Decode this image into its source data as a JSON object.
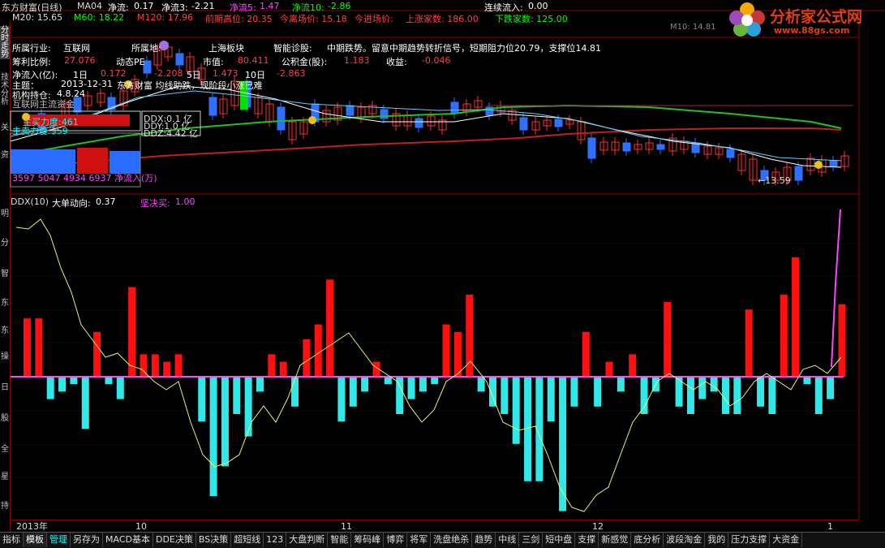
{
  "header": {
    "title": "东方财富(日线)",
    "ma_label": "MA04",
    "j1_label": "净流:",
    "j1_value": "0.17",
    "j3_label": "净流3:",
    "j3_value": "-2.21",
    "j5_label": "净流5:",
    "j5_value": "1.47",
    "j10_label": "净流10:",
    "j10_value": "-2.86",
    "continuous_label": "连续流入:",
    "continuous_value": "0.00",
    "m20": "M20: 15.65",
    "m60": "M60: 18.22",
    "m120": "M120: 17.96",
    "prev_high": "前期高位: 20.35",
    "today_price": "今离场价: 15.18",
    "today_in": "今进场价:",
    "up_count": "上涨家数: 186.00",
    "down_count": "下跌家数: 125.00",
    "m10_label": "M10: 14.81"
  },
  "info": {
    "industry_label": "所属行业:",
    "industry_value": "互联网",
    "block_label": "所属地:",
    "block_value": "上海板块",
    "diag_label": "智能诊股:",
    "diag_value": "中期跌势。留意中期趋势转折信号，短期阻力位20.79，支撑位14.81",
    "ratio_label": "筹利比例:",
    "ratio_value": "27.076",
    "pe_label": "动态PE",
    "mv_label": "市值:",
    "mv_value": "80.411",
    "reserve_label": "公积金(股):",
    "reserve_value": "1.183",
    "income_label": "收益:",
    "income_value": "-0.046",
    "inflow_label": "净流入(亿):",
    "d1": "1日",
    "d1v": "0.172",
    "d5v": "-2.208",
    "d5": "5日",
    "d5b": "1.473",
    "d10": "10日",
    "d10v": "-2.863",
    "news_date": "2013-12-31",
    "news_text": "东方财富 均线助跌，现阶段小涨已难",
    "inst_label": "机构持仓:",
    "inst_value": "4.8.24",
    "trend_label": "互联网主流资金",
    "main_label": "主买力度:461",
    "main_label2": "主卖力度:359",
    "box_r1": "DDX:0.1 亿",
    "box_r2": "DDY:1.0 亿",
    "box_r3": "DDZ:4.42 亿",
    "vals_row": "3597  5047   4934  6937  净流入(万)",
    "low_mark": "←13.59",
    "cursor_value": "13.59"
  },
  "indicator": {
    "name": "DDX(10)",
    "dir_label": "大单动向:",
    "dir_value": "0.37",
    "buy_label": "坚决买:",
    "buy_value": "1.00"
  },
  "axis": {
    "labels": [
      "2013年",
      "10",
      "11",
      "12",
      "1"
    ]
  },
  "sidebar": {
    "items": [
      "分",
      "时",
      "走",
      "势",
      "技",
      "术",
      "分",
      "析",
      "关",
      "资",
      "明",
      "分",
      "智",
      "东",
      "东",
      "操",
      "日",
      "股",
      "全",
      "星",
      "持",
      "资"
    ]
  },
  "logo": {
    "name": "分析家公式网",
    "url": "www.88gs.com"
  },
  "toolbar": {
    "buttons": [
      "指标",
      "模板",
      "管理",
      "另存为",
      "MACD基本",
      "DDE决策",
      "BS决策",
      "超短线",
      "123",
      "大盘判断",
      "智能",
      "筹码峰",
      "博弈",
      "将军",
      "洗盘绝杀",
      "趋势",
      "中线",
      "三剑",
      "短中盘",
      "支撑",
      "新感觉",
      "底分析",
      "波段淘金",
      "我的",
      "压力支撑",
      "大资金"
    ]
  },
  "chart_data": {
    "type": "bar",
    "title": "DDX(10)",
    "series": [
      {
        "name": "大单动向",
        "values": [
          0.78,
          0.78,
          -0.3,
          -0.2,
          -0.1,
          -0.7,
          0.6,
          -0.1,
          -0.3,
          1.2,
          0.3,
          0.3,
          0.2,
          0.3,
          0.0,
          -0.6,
          -1.6,
          -1.2,
          -0.5,
          -0.8,
          -0.2,
          0.3,
          0.2,
          -0.4,
          0.5,
          0.7,
          1.3,
          -0.6,
          -0.4,
          -0.2,
          0.2,
          -0.1,
          -0.5,
          -0.3,
          -0.2,
          -0.1,
          0.7,
          0.6,
          1.1,
          -0.2,
          -0.4,
          -0.5,
          -0.9,
          -1.4,
          -1.4,
          -0.6,
          -1.8,
          -0.4,
          0.6,
          -0.4,
          0.2,
          -0.2,
          0.3,
          -0.5,
          -0.2,
          1.0,
          -0.4,
          -0.5,
          -0.3,
          -0.2,
          -0.5,
          -0.5,
          0.9,
          -0.4,
          -0.5,
          1.1,
          1.6,
          -0.1,
          -0.5,
          -0.3,
          0.97
        ]
      }
    ],
    "ylim": [
      -2.2,
      2.1
    ]
  }
}
